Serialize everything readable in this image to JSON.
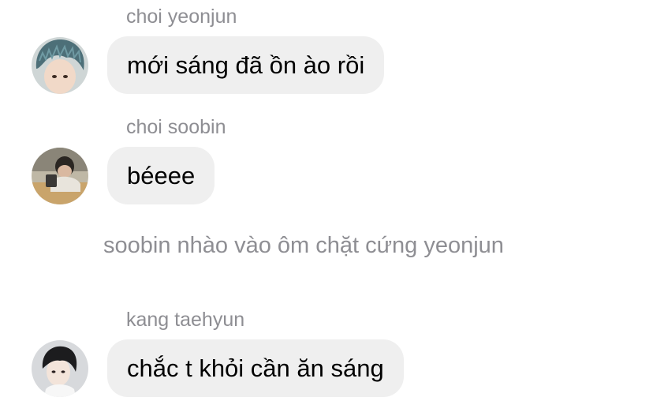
{
  "messages": [
    {
      "sender": "choi yeonjun",
      "text": "mới sáng đã ồn ào rồi",
      "avatar_icon": "avatar-blue-hair-icon"
    },
    {
      "sender": "choi soobin",
      "text": "béeee",
      "avatar_icon": "avatar-photo-icon"
    },
    {
      "sender": "kang taehyun",
      "text": "chắc t khỏi cần ăn sáng",
      "avatar_icon": "avatar-dark-hair-icon"
    }
  ],
  "system_message": "soobin nhào vào ôm chặt cứng yeonjun",
  "colors": {
    "bubble_background": "#efefef",
    "sender_text": "#8e8e93",
    "message_text": "#000000",
    "page_background": "#ffffff"
  }
}
